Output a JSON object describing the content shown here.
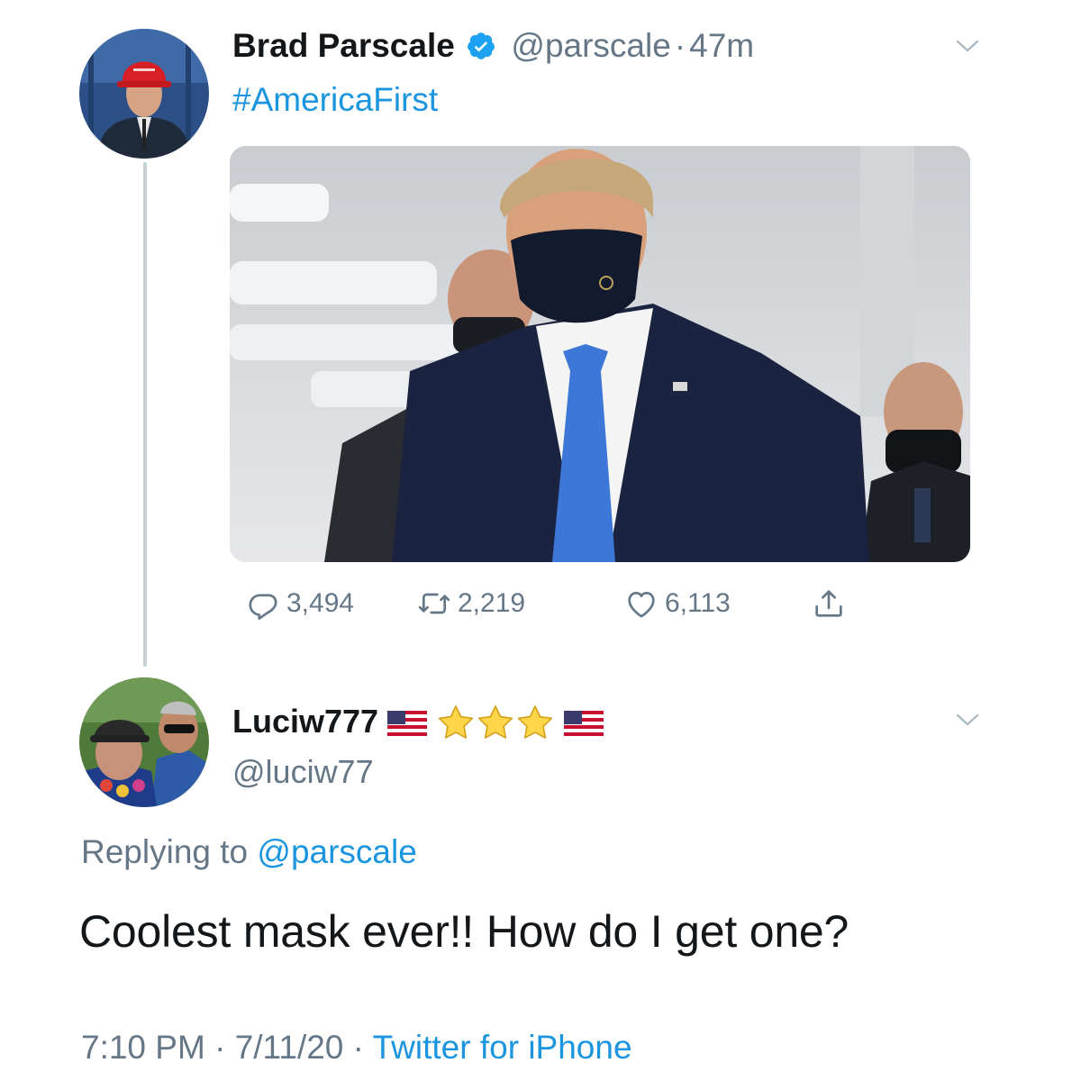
{
  "tweet": {
    "author_name": "Brad Parscale",
    "handle": "@parscale",
    "separator": "·",
    "time_ago": "47m",
    "text": "#AmericaFirst",
    "verified": true,
    "actions": {
      "replies": "3,494",
      "retweets": "2,219",
      "likes": "6,113"
    },
    "icons": [
      "verified-badge-icon",
      "chevron-down-icon",
      "reply-icon",
      "retweet-icon",
      "like-icon",
      "share-icon"
    ]
  },
  "reply": {
    "display_name": "Luciw777",
    "name_decorations": [
      "us-flag-icon",
      "star-icon",
      "star-icon",
      "star-icon",
      "us-flag-icon"
    ],
    "handle": "@luciw77",
    "replying_label": "Replying to",
    "replying_handle": "@parscale",
    "text": "Coolest mask ever!! How do I get one?",
    "time": "7:10 PM",
    "date": "7/11/20",
    "separator": "·",
    "source": "Twitter for iPhone"
  },
  "colors": {
    "link": "#1b95e0",
    "muted": "#657786",
    "text": "#14171a",
    "verified": "#1da1f2",
    "thread_line": "#c4cfd6"
  }
}
